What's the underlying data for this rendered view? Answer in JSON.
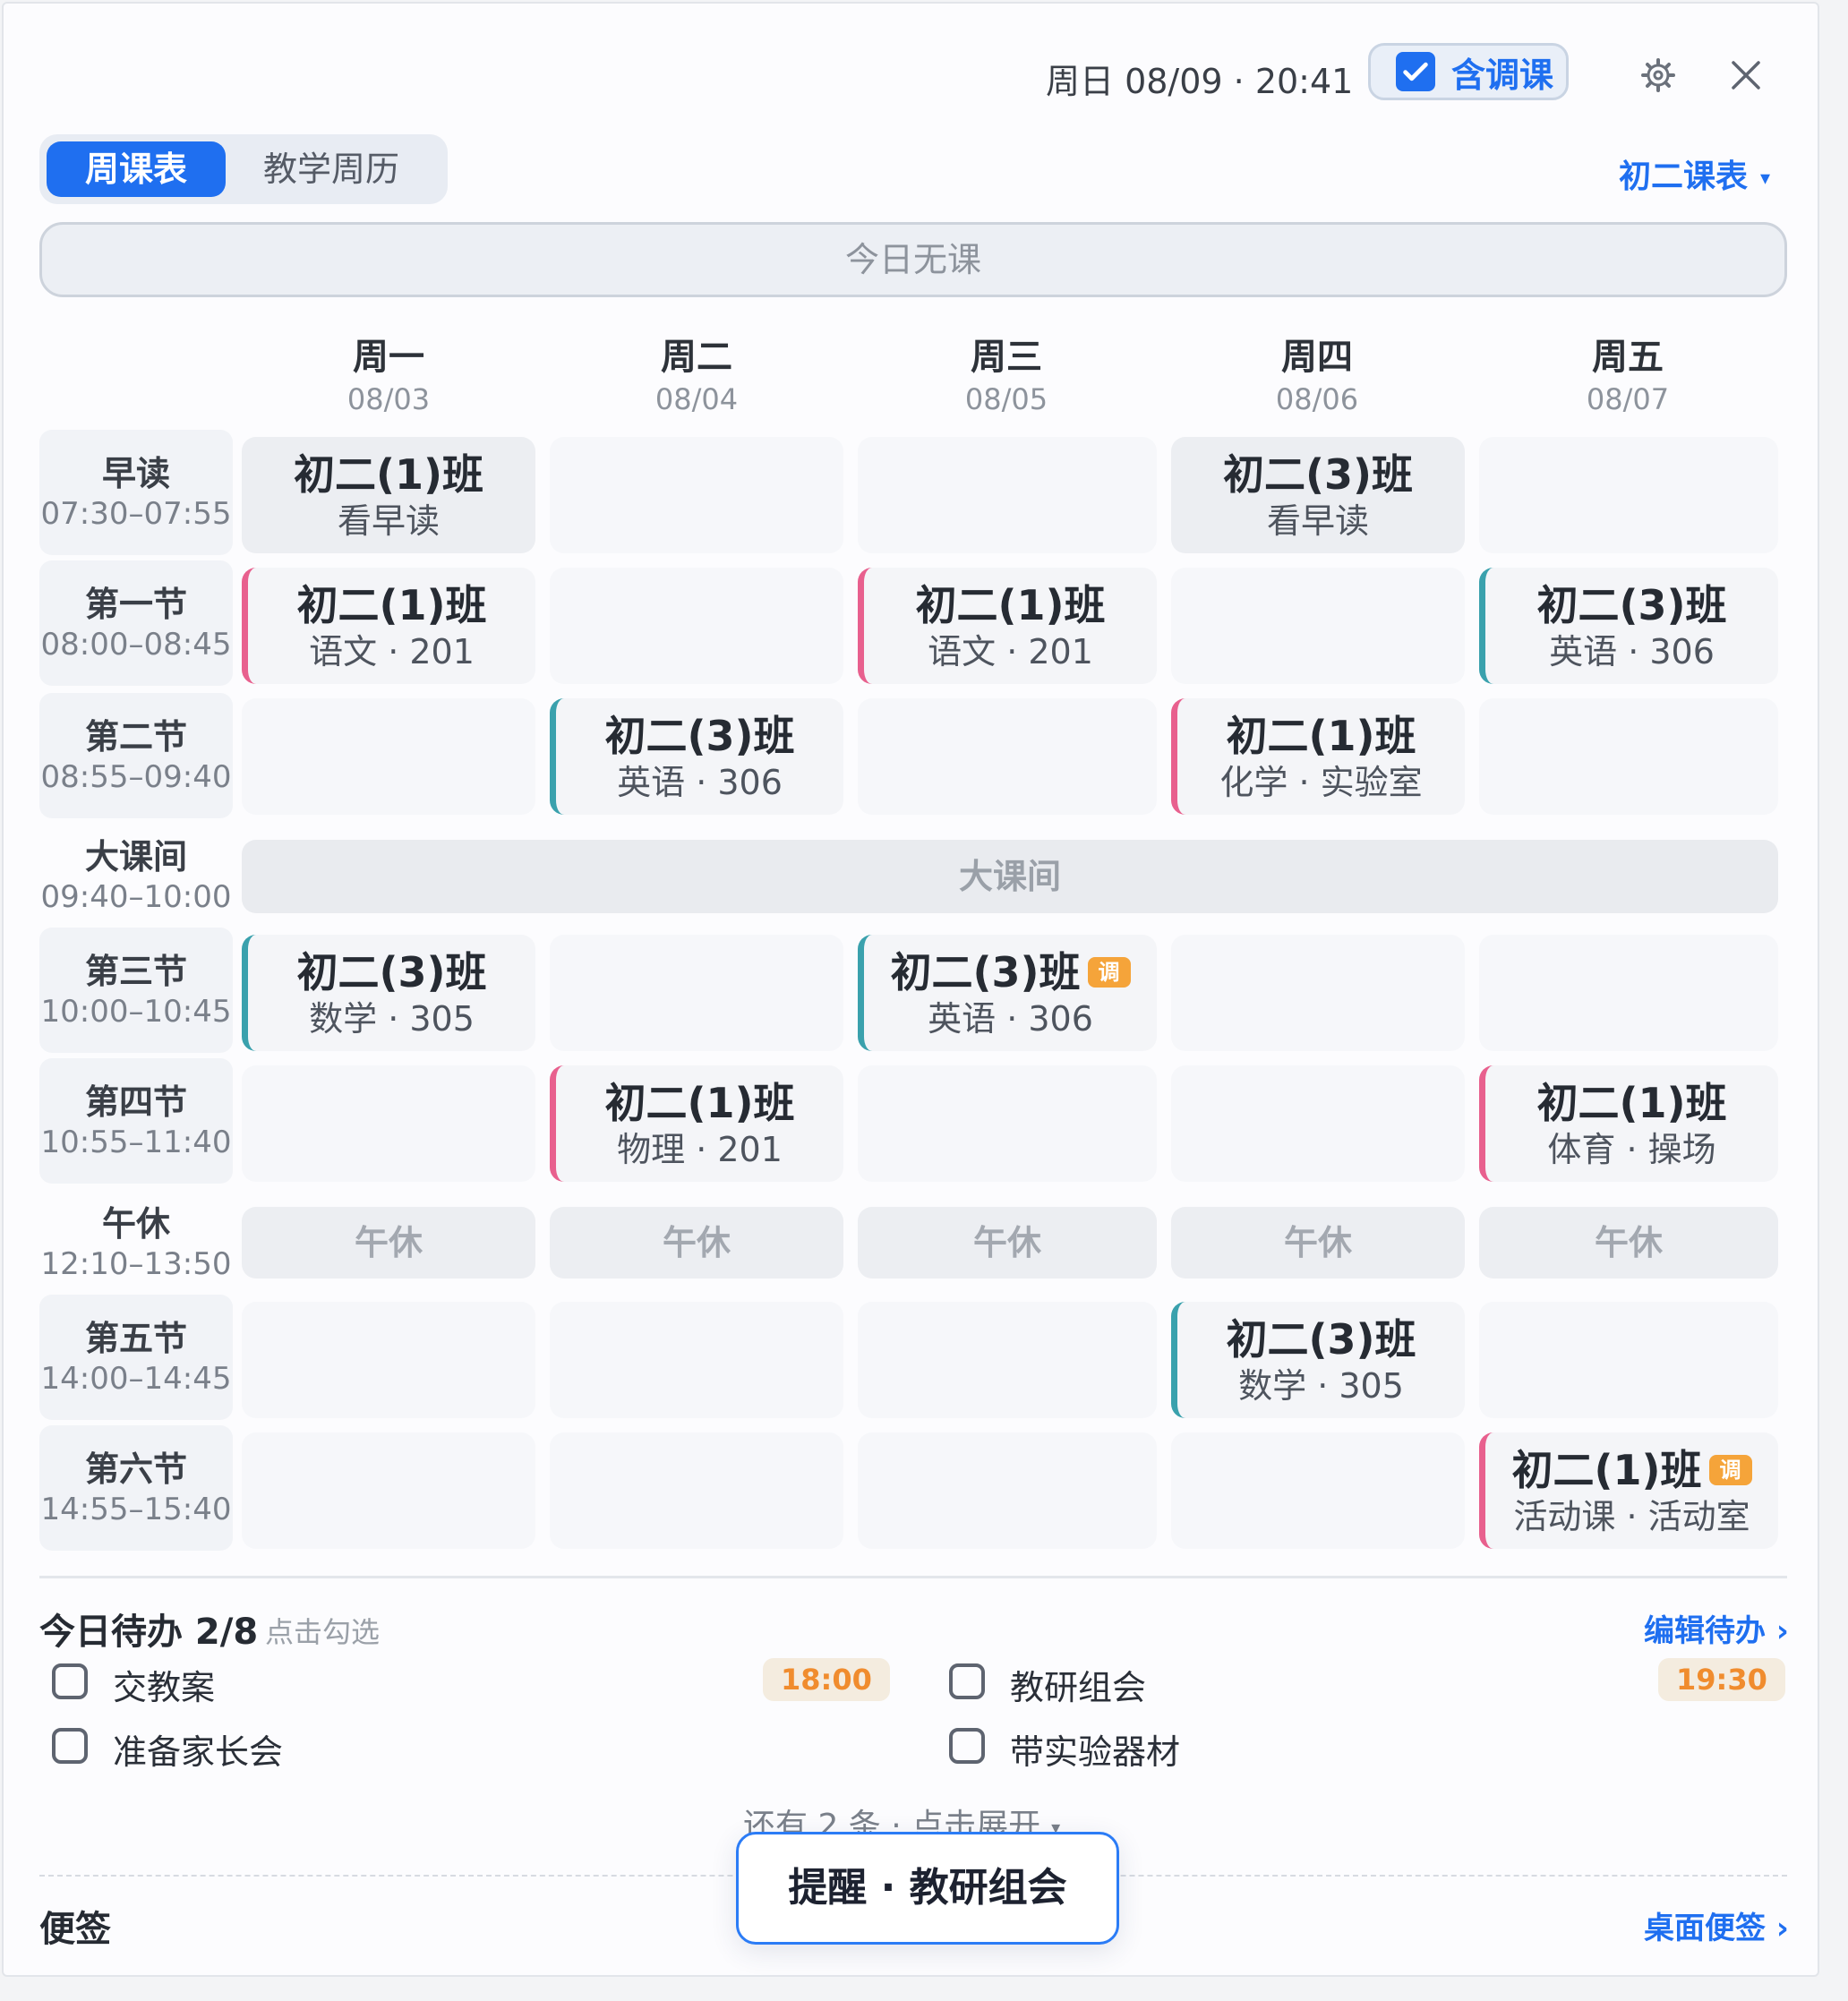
{
  "header": {
    "datetime": "周日 08/09 · 20:41",
    "adjust_toggle_label": "含调课",
    "adjust_checked": true
  },
  "icons": {
    "settings": "gear-icon",
    "close": "close-icon",
    "checkbox": "checkbox-icon"
  },
  "tabs": {
    "weekly": "周课表",
    "calendar": "教学周历",
    "active": "weekly"
  },
  "schedule_select": {
    "label": "初二课表",
    "caret": "▾"
  },
  "today_banner": "今日无课",
  "days": [
    {
      "name": "周一",
      "date": "08/03"
    },
    {
      "name": "周二",
      "date": "08/04"
    },
    {
      "name": "周三",
      "date": "08/05"
    },
    {
      "name": "周四",
      "date": "08/06"
    },
    {
      "name": "周五",
      "date": "08/07"
    }
  ],
  "periods": [
    {
      "name": "早读",
      "time": "07:30–07:55"
    },
    {
      "name": "第一节",
      "time": "08:00–08:45"
    },
    {
      "name": "第二节",
      "time": "08:55–09:40"
    },
    {
      "name": "大课间",
      "time": "09:40–10:00"
    },
    {
      "name": "第三节",
      "time": "10:00–10:45"
    },
    {
      "name": "第四节",
      "time": "10:55–11:40"
    },
    {
      "name": "午休",
      "time": "12:10–13:50"
    },
    {
      "name": "第五节",
      "time": "14:00–14:45"
    },
    {
      "name": "第六节",
      "time": "14:55–15:40"
    }
  ],
  "big_break_label": "大课间",
  "lunch_label": "午休",
  "adjust_badge": "调",
  "classes": [
    {
      "title": "初二(1)班",
      "sub": "看早读",
      "adjusted": false
    },
    {
      "title": "初二(3)班",
      "sub": "看早读",
      "adjusted": false
    },
    {
      "title": "初二(1)班",
      "sub": "语文 · 201",
      "adjusted": false
    },
    {
      "title": "初二(1)班",
      "sub": "语文 · 201",
      "adjusted": false
    },
    {
      "title": "初二(3)班",
      "sub": "英语 · 306",
      "adjusted": false
    },
    {
      "title": "初二(3)班",
      "sub": "英语 · 306",
      "adjusted": false
    },
    {
      "title": "初二(1)班",
      "sub": "化学 · 实验室",
      "adjusted": false
    },
    {
      "title": "初二(3)班",
      "sub": "数学 · 305",
      "adjusted": false
    },
    {
      "title": "初二(3)班",
      "sub": "英语 · 306",
      "adjusted": true
    },
    {
      "title": "初二(1)班",
      "sub": "物理 · 201",
      "adjusted": false
    },
    {
      "title": "初二(1)班",
      "sub": "体育 · 操场",
      "adjusted": false
    },
    {
      "title": "初二(3)班",
      "sub": "数学 · 305",
      "adjusted": false
    },
    {
      "title": "初二(1)班",
      "sub": "活动课 · 活动室",
      "adjusted": true
    }
  ],
  "colors": {
    "accent": "#1f6ff0",
    "class1": "#e8608e",
    "class3": "#3aa1ad",
    "badge": "#f5a43a",
    "time_chip": "#f08c2e"
  },
  "todos": {
    "title": "今日待办 2/8",
    "hint": "点击勾选",
    "edit_link": "编辑待办 ›",
    "items": [
      {
        "text": "交教案",
        "time": "18:00",
        "done": false
      },
      {
        "text": "教研组会",
        "time": "19:30",
        "done": false
      },
      {
        "text": "准备家长会",
        "time": "",
        "done": false
      },
      {
        "text": "带实验器材",
        "time": "",
        "done": false
      }
    ],
    "more": "还有 2 条 · 点击展开",
    "more_caret": "▾"
  },
  "notes": {
    "title": "便签",
    "desktop_link": "桌面便签 ›"
  },
  "toast": "提醒 · 教研组会"
}
